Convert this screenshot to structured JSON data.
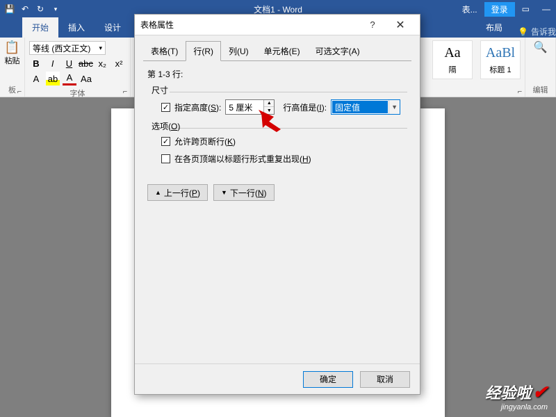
{
  "titlebar": {
    "doc_title": "文档1 - Word",
    "table_context": "表...",
    "login": "登录"
  },
  "ribbon": {
    "tabs": {
      "home": "开始",
      "insert": "插入",
      "design": "设计",
      "layout": "布局",
      "tell_me": "告诉我"
    },
    "font_group_label": "字体",
    "font_name": "等线 (西文正文)",
    "font_size": "",
    "clipboard": {
      "paste": "粘贴",
      "group_label": "板"
    },
    "styles": {
      "normal_label": "隔",
      "heading1_label": "标题 1",
      "preview": "AaBl"
    },
    "edit_label": "编辑"
  },
  "dialog": {
    "title": "表格属性",
    "tabs": {
      "table": "表格(T)",
      "row": "行(R)",
      "column": "列(U)",
      "cell": "单元格(E)",
      "alt": "可选文字(A)"
    },
    "rows_range": "第 1-3 行:",
    "size_section": "尺寸",
    "specify_height": "指定高度(S):",
    "height_value": "5 厘米",
    "row_height_is": "行高值是(I):",
    "row_height_mode": "固定值",
    "options_section": "选项(O)",
    "allow_break": "允许跨页断行(K)",
    "repeat_header": "在各页顶端以标题行形式重复出现(H)",
    "prev_row": "上一行(P)",
    "next_row": "下一行(N)",
    "ok": "确定",
    "cancel": "取消"
  },
  "watermark": {
    "main": "经验啦",
    "sub": "jingyanla.com"
  }
}
